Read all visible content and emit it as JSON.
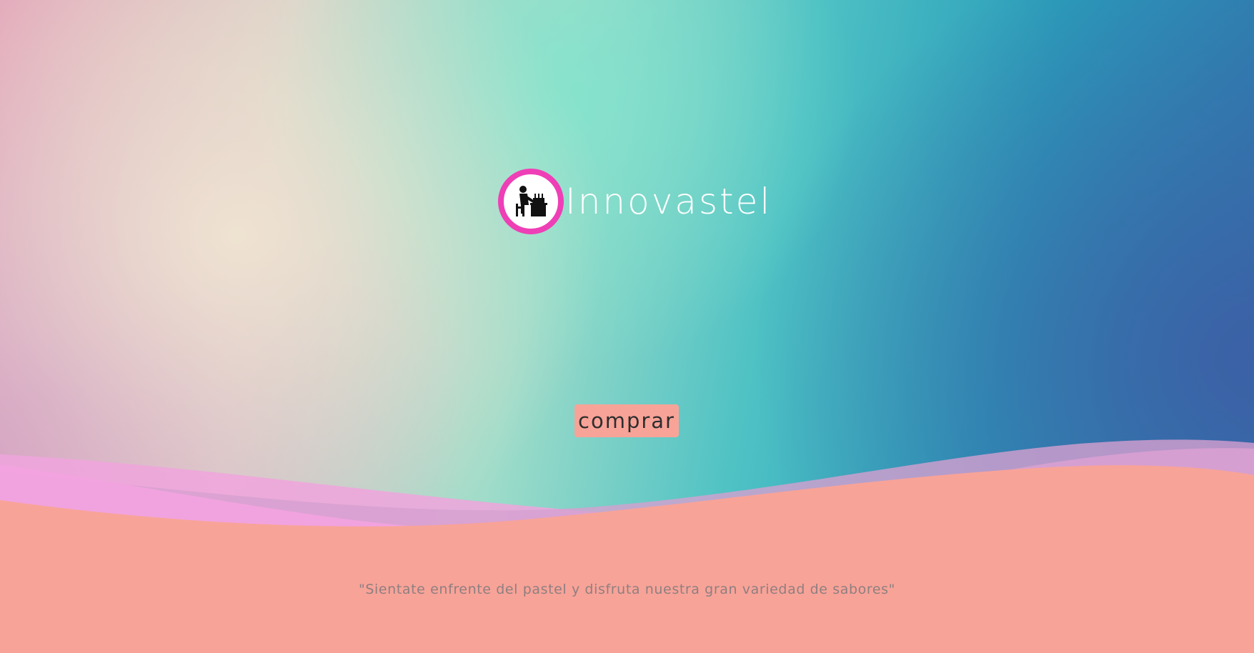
{
  "brand": {
    "name": "Innovastel",
    "logo_icon": "person-at-cake-table-icon",
    "logo_ring_color": "#ee3fb6"
  },
  "hero": {
    "cta_label": "comprar",
    "cta_color": "#f8a398"
  },
  "footer": {
    "tagline": "\"Sientate enfrente del pastel y disfruta nuestra gran variedad de sabores\"",
    "background_color": "#f8a398"
  },
  "colors": {
    "wave_pink": "#f2a6df",
    "wave_mauve": "#d8a3cf"
  }
}
